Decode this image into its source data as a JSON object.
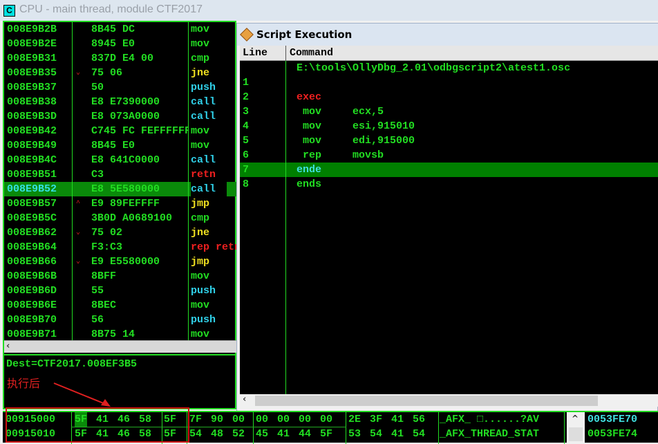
{
  "window": {
    "title": "CPU - main thread, module CTF2017",
    "icon_letter": "C"
  },
  "disasm": [
    {
      "addr": "008E9B2B",
      "hex": "8B45 DC",
      "mn": "mov",
      "color": "#22dd22",
      "jmp": ""
    },
    {
      "addr": "008E9B2E",
      "hex": "8945 E0",
      "mn": "mov",
      "color": "#22dd22",
      "jmp": ""
    },
    {
      "addr": "008E9B31",
      "hex": "837D E4 00",
      "mn": "cmp",
      "color": "#22dd22",
      "jmp": ""
    },
    {
      "addr": "008E9B35",
      "hex": "75 06",
      "mn": "jne",
      "color": "#f0e020",
      "jmp": "⌄"
    },
    {
      "addr": "008E9B37",
      "hex": "50",
      "mn": "push",
      "color": "#30d0e8",
      "jmp": ""
    },
    {
      "addr": "008E9B38",
      "hex": "E8 E7390000",
      "mn": "call",
      "color": "#30d0e8",
      "jmp": ""
    },
    {
      "addr": "008E9B3D",
      "hex": "E8 073A0000",
      "mn": "call",
      "color": "#30d0e8",
      "jmp": ""
    },
    {
      "addr": "008E9B42",
      "hex": "C745 FC FEFFFFFF",
      "mn": "mov",
      "color": "#22dd22",
      "jmp": ""
    },
    {
      "addr": "008E9B49",
      "hex": "8B45 E0",
      "mn": "mov",
      "color": "#22dd22",
      "jmp": ""
    },
    {
      "addr": "008E9B4C",
      "hex": "E8 641C0000",
      "mn": "call",
      "color": "#30d0e8",
      "jmp": ""
    },
    {
      "addr": "008E9B51",
      "hex": "C3",
      "mn": "retn",
      "color": "#ee2020",
      "jmp": ""
    },
    {
      "addr": "008E9B52",
      "hex": "E8 5E580000",
      "mn": "call",
      "color": "#30d0e8",
      "jmp": "",
      "selected": true
    },
    {
      "addr": "008E9B57",
      "hex": "E9 89FEFFFF",
      "mn": "jmp",
      "color": "#f0e020",
      "jmp": "^"
    },
    {
      "addr": "008E9B5C",
      "hex": "3B0D A0689100",
      "mn": "cmp",
      "color": "#22dd22",
      "jmp": ""
    },
    {
      "addr": "008E9B62",
      "hex": "75 02",
      "mn": "jne",
      "color": "#f0e020",
      "jmp": "⌄"
    },
    {
      "addr": "008E9B64",
      "hex": "F3:C3",
      "mn": "rep retn",
      "color": "#ee2020",
      "jmp": ""
    },
    {
      "addr": "008E9B66",
      "hex": "E9 E5580000",
      "mn": "jmp",
      "color": "#f0e020",
      "jmp": "⌄"
    },
    {
      "addr": "008E9B6B",
      "hex": "8BFF",
      "mn": "mov",
      "color": "#22dd22",
      "jmp": ""
    },
    {
      "addr": "008E9B6D",
      "hex": "55",
      "mn": "push",
      "color": "#30d0e8",
      "jmp": ""
    },
    {
      "addr": "008E9B6E",
      "hex": "8BEC",
      "mn": "mov",
      "color": "#22dd22",
      "jmp": ""
    },
    {
      "addr": "008E9B70",
      "hex": "56",
      "mn": "push",
      "color": "#30d0e8",
      "jmp": ""
    },
    {
      "addr": "008E9B71",
      "hex": "8B75 14",
      "mn": "mov",
      "color": "#22dd22",
      "jmp": ""
    }
  ],
  "info": {
    "text": "Dest=CTF2017.008EF3B5",
    "annotation": "执行后"
  },
  "script": {
    "title": "Script Execution",
    "col_line": "Line",
    "col_command": "Command",
    "rows": [
      {
        "line": "",
        "cmd": "E:\\tools\\OllyDbg_2.01\\odbgscript2\\atest1.osc",
        "color": "#22dd22"
      },
      {
        "line": "1",
        "cmd": "",
        "color": "#22dd22"
      },
      {
        "line": "2",
        "cmd": "exec",
        "color": "#ee2020"
      },
      {
        "line": "3",
        "cmd": " mov     ecx,5",
        "color": "#22dd22"
      },
      {
        "line": "4",
        "cmd": " mov     esi,915010",
        "color": "#22dd22"
      },
      {
        "line": "5",
        "cmd": " mov     edi,915000",
        "color": "#22dd22"
      },
      {
        "line": "6",
        "cmd": " rep     movsb",
        "color": "#22dd22"
      },
      {
        "line": "7",
        "cmd": "ende",
        "color": "#40e0e0",
        "selected": true
      },
      {
        "line": "8",
        "cmd": "ends",
        "color": "#22dd22"
      }
    ]
  },
  "dump": [
    {
      "addr": "00915000",
      "b": [
        "5F",
        "41",
        "46",
        "58",
        "5F",
        "7F",
        "90",
        "00",
        "00",
        "00",
        "00",
        "00",
        "2E",
        "3F",
        "41",
        "56"
      ],
      "ascii": "_AFX_ □......?AV",
      "stack": "0053FE70"
    },
    {
      "addr": "00915010",
      "b": [
        "5F",
        "41",
        "46",
        "58",
        "5F",
        "54",
        "48",
        "52",
        "45",
        "41",
        "44",
        "5F",
        "53",
        "54",
        "41",
        "54"
      ],
      "ascii": "_AFX_THREAD_STAT",
      "stack": "0053FE74"
    }
  ]
}
